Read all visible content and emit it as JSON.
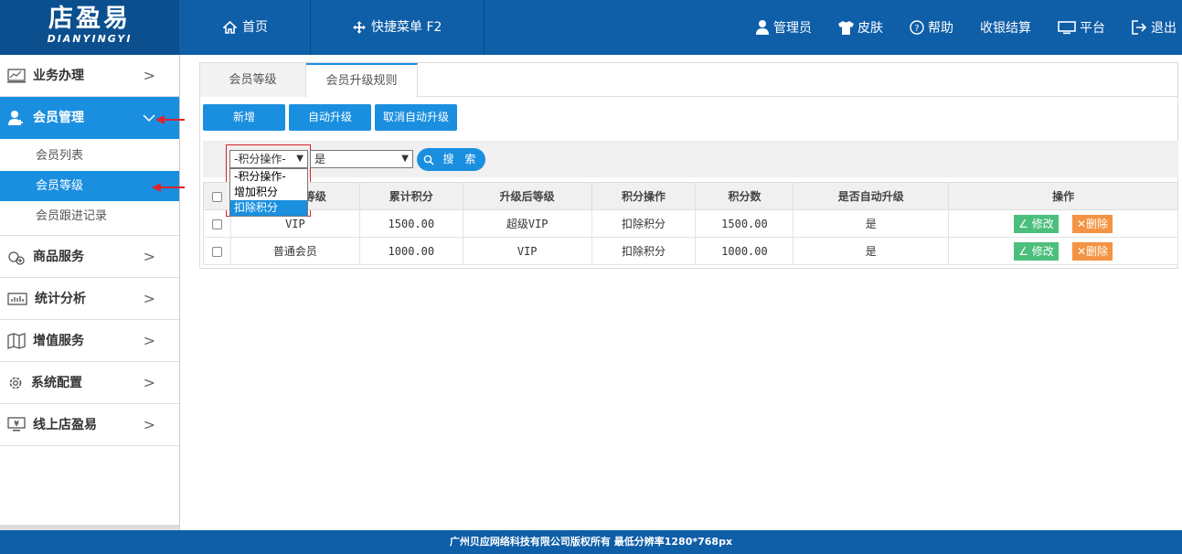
{
  "header": {
    "logo_main": "店盈易",
    "logo_sub": "DIANYINGYI",
    "nav_left": [
      {
        "label": "首页",
        "icon": "home-icon"
      },
      {
        "label": "快捷菜单 F2",
        "icon": "move-icon"
      }
    ],
    "nav_right": [
      {
        "label": "管理员",
        "icon": "user-icon"
      },
      {
        "label": "皮肤",
        "icon": "shirt-icon"
      },
      {
        "label": "帮助",
        "icon": "help-icon"
      },
      {
        "label": "收银结算",
        "icon": ""
      },
      {
        "label": "平台",
        "icon": "monitor-icon"
      },
      {
        "label": "退出",
        "icon": "logout-icon"
      }
    ]
  },
  "sidebar": {
    "groups": [
      {
        "label": "业务办理",
        "icon": "chart-icon"
      },
      {
        "label": "会员管理",
        "icon": "member-icon"
      },
      {
        "label": "商品服务",
        "icon": "goods-icon"
      },
      {
        "label": "统计分析",
        "icon": "stats-icon"
      },
      {
        "label": "增值服务",
        "icon": "map-icon"
      },
      {
        "label": "系统配置",
        "icon": "gear-icon"
      },
      {
        "label": "线上店盈易",
        "icon": "yen-monitor-icon"
      }
    ],
    "member_sub": [
      "会员列表",
      "会员等级",
      "会员跟进记录"
    ]
  },
  "tabs": [
    "会员等级",
    "会员升级规则"
  ],
  "toolbar": {
    "add": "新增",
    "auto": "自动升级",
    "cancel_auto": "取消自动升级"
  },
  "search": {
    "select1_value": "-积分操作-",
    "select2_value": "是",
    "button": "搜 索",
    "dropdown_options": [
      "-积分操作-",
      "增加积分",
      "扣除积分"
    ]
  },
  "table": {
    "headers": [
      "等级",
      "累计积分",
      "升级后等级",
      "积分操作",
      "积分数",
      "是否自动升级",
      "操作"
    ],
    "rows": [
      {
        "level": "VIP",
        "points": "1500.00",
        "next": "超级VIP",
        "op": "扣除积分",
        "amount": "1500.00",
        "auto": "是"
      },
      {
        "level": "普通会员",
        "points": "1000.00",
        "next": "VIP",
        "op": "扣除积分",
        "amount": "1000.00",
        "auto": "是"
      }
    ],
    "edit": "修改",
    "delete": "删除"
  },
  "footer": "广州贝应网络科技有限公司版权所有 最低分辨率1280*768px",
  "colors": {
    "header": "#0e5ea8",
    "accent": "#1a8fe0",
    "edit": "#4cbf7d",
    "delete": "#f39343"
  }
}
